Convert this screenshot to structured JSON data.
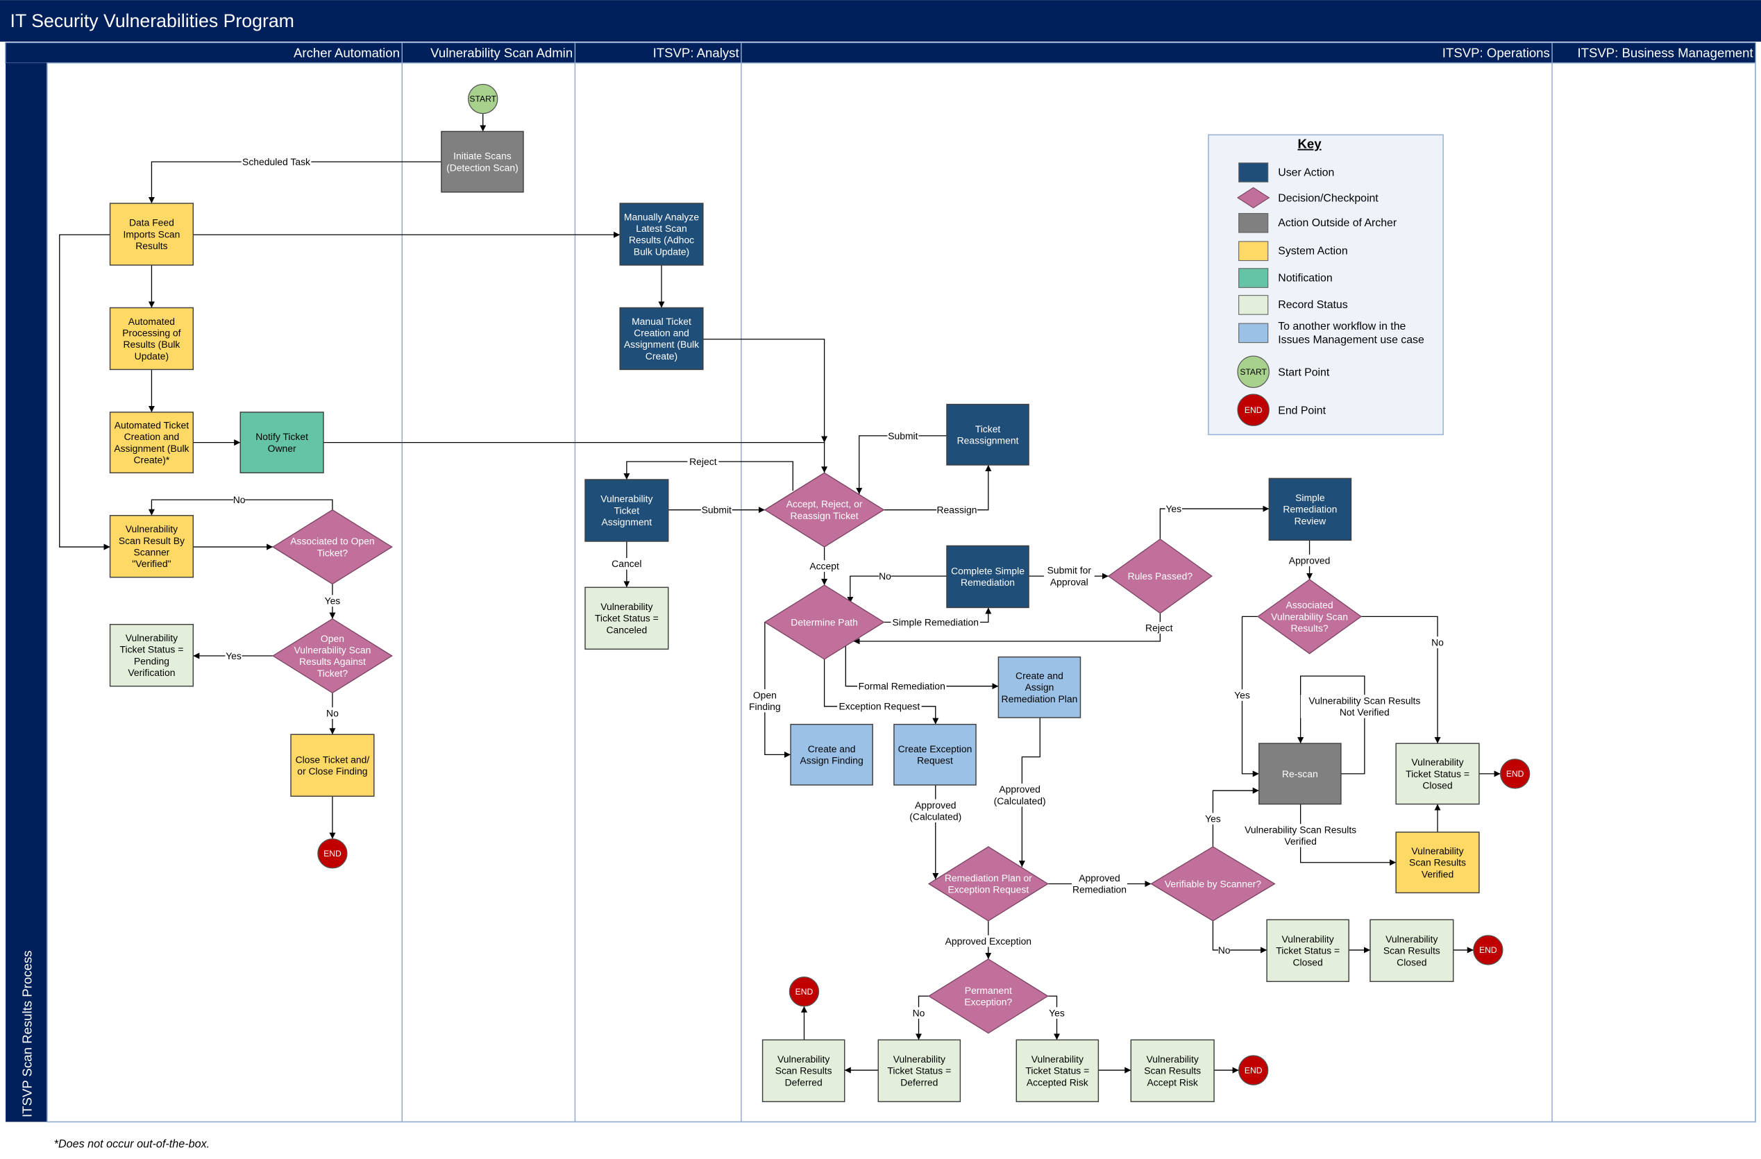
{
  "title": "IT Security Vulnerabilities Program",
  "process_label": "ITSVP Scan Results Process",
  "lanes": [
    "Archer Automation",
    "Vulnerability Scan Admin",
    "ITSVP: Analyst",
    "ITSVP: Operations",
    "ITSVP: Business Management"
  ],
  "footnote": "*Does not occur out-of-the-box.",
  "colors": {
    "header": "#00205B",
    "user_action": "#1F4E79",
    "decision": "#C0709A",
    "outside_archer": "#808080",
    "system_action": "#FFD966",
    "notification": "#66C4A6",
    "record_status": "#E3EFDA",
    "other_workflow": "#9BC2E6",
    "start": "#A9D18E",
    "end": "#C00000"
  },
  "key": {
    "title": "Key",
    "items": [
      {
        "type": "user_action",
        "label": "User Action"
      },
      {
        "type": "decision",
        "label": "Decision/Checkpoint"
      },
      {
        "type": "outside_archer",
        "label": "Action Outside of Archer"
      },
      {
        "type": "system_action",
        "label": "System Action"
      },
      {
        "type": "notification",
        "label": "Notification"
      },
      {
        "type": "record_status",
        "label": "Record Status"
      },
      {
        "type": "other_workflow",
        "label": "To another workflow in the\nIssues Management use case"
      },
      {
        "type": "start",
        "label": "Start Point",
        "symbol": "START"
      },
      {
        "type": "end",
        "label": "End Point",
        "symbol": "END"
      }
    ]
  },
  "nodes": {
    "start1": {
      "type": "start",
      "label": "START"
    },
    "initiate": {
      "type": "outside_archer",
      "label": "Initiate Scans\n(Detection Scan)"
    },
    "datafeed": {
      "type": "system_action",
      "label": "Data Feed\nImports Scan\nResults"
    },
    "autoproc": {
      "type": "system_action",
      "label": "Automated\nProcessing of\nResults (Bulk\nUpdate)"
    },
    "autoticket": {
      "type": "system_action",
      "label": "Automated Ticket\nCreation and\nAssignment (Bulk\nCreate)*"
    },
    "notify": {
      "type": "notification",
      "label": "Notify Ticket\nOwner"
    },
    "vsr_verified": {
      "type": "system_action",
      "label": "Vulnerability\nScan Result By\nScanner\n\"Verified\""
    },
    "dec_assoc_open": {
      "type": "decision",
      "label": "Associated to Open\nTicket?"
    },
    "dec_open_vsr": {
      "type": "decision",
      "label": "Open\nVulnerability Scan\nResults Against\nTicket?"
    },
    "pending": {
      "type": "record_status",
      "label": "Vulnerability\nTicket Status =\nPending\nVerification"
    },
    "close_ticket": {
      "type": "system_action",
      "label": "Close Ticket and/\nor Close Finding"
    },
    "end1": {
      "type": "end",
      "label": "END"
    },
    "manual_analyze": {
      "type": "user_action",
      "label": "Manually Analyze\nLatest Scan\nResults (Adhoc\nBulk Update)"
    },
    "manual_ticket": {
      "type": "user_action",
      "label": "Manual Ticket\nCreation and\nAssignment (Bulk\nCreate)"
    },
    "vta": {
      "type": "user_action",
      "label": "Vulnerability\nTicket\nAssignment"
    },
    "canceled": {
      "type": "record_status",
      "label": "Vulnerability\nTicket Status =\nCanceled"
    },
    "dec_accept": {
      "type": "decision",
      "label": "Accept, Reject, or\nReassign Ticket"
    },
    "ticket_reassign": {
      "type": "user_action",
      "label": "Ticket\nReassignment"
    },
    "dec_path": {
      "type": "decision",
      "label": "Determine Path"
    },
    "complete_simple": {
      "type": "user_action",
      "label": "Complete Simple\nRemediation"
    },
    "dec_rules": {
      "type": "decision",
      "label": "Rules Passed?"
    },
    "simple_review": {
      "type": "user_action",
      "label": "Simple\nRemediation\nReview"
    },
    "dec_assoc_vsr": {
      "type": "decision",
      "label": "Associated\nVulnerability Scan\nResults?"
    },
    "rescan": {
      "type": "outside_archer",
      "label": "Re-scan"
    },
    "vts_closed1": {
      "type": "record_status",
      "label": "Vulnerability\nTicket Status =\nClosed"
    },
    "end_a": {
      "type": "end",
      "label": "END"
    },
    "vsr_verified2": {
      "type": "system_action",
      "label": "Vulnerability\nScan Results\nVerified"
    },
    "create_plan": {
      "type": "other_workflow",
      "label": "Create and\nAssign\nRemediation Plan"
    },
    "create_finding": {
      "type": "other_workflow",
      "label": "Create and\nAssign Finding"
    },
    "create_exception": {
      "type": "other_workflow",
      "label": "Create Exception\nRequest"
    },
    "dec_plan": {
      "type": "decision",
      "label": "Remediation Plan or\nException Request"
    },
    "dec_verifiable": {
      "type": "decision",
      "label": "Verifiable by Scanner?"
    },
    "vts_closed2": {
      "type": "record_status",
      "label": "Vulnerability\nTicket Status =\nClosed"
    },
    "vsr_closed": {
      "type": "record_status",
      "label": "Vulnerability\nScan Results\nClosed"
    },
    "end_b": {
      "type": "end",
      "label": "END"
    },
    "dec_perm": {
      "type": "decision",
      "label": "Permanent\nException?"
    },
    "vsr_deferred": {
      "type": "record_status",
      "label": "Vulnerability\nScan Results\nDeferred"
    },
    "vts_deferred": {
      "type": "record_status",
      "label": "Vulnerability\nTicket Status =\nDeferred"
    },
    "vts_accepted": {
      "type": "record_status",
      "label": "Vulnerability\nTicket Status =\nAccepted Risk"
    },
    "vsr_accept": {
      "type": "record_status",
      "label": "Vulnerability\nScan Results\nAccept Risk"
    },
    "end_c": {
      "type": "end",
      "label": "END"
    },
    "end_d": {
      "type": "end",
      "label": "END"
    }
  },
  "edges": [
    {
      "from": "start1",
      "to": "initiate",
      "label": ""
    },
    {
      "from": "initiate",
      "to": "datafeed",
      "label": "Scheduled Task"
    },
    {
      "from": "datafeed",
      "to": "manual_analyze",
      "label": ""
    },
    {
      "from": "datafeed",
      "to": "vsr_verified",
      "label": ""
    },
    {
      "from": "datafeed",
      "to": "autoproc",
      "label": ""
    },
    {
      "from": "autoproc",
      "to": "autoticket",
      "label": ""
    },
    {
      "from": "autoticket",
      "to": "notify",
      "label": ""
    },
    {
      "from": "notify",
      "to": "dec_accept",
      "label": ""
    },
    {
      "from": "manual_analyze",
      "to": "manual_ticket",
      "label": ""
    },
    {
      "from": "manual_ticket",
      "to": "dec_accept",
      "label": ""
    },
    {
      "from": "vsr_verified",
      "to": "dec_assoc_open",
      "label": ""
    },
    {
      "from": "dec_assoc_open",
      "to": "vsr_verified",
      "label": "No"
    },
    {
      "from": "dec_assoc_open",
      "to": "dec_open_vsr",
      "label": "Yes"
    },
    {
      "from": "dec_open_vsr",
      "to": "pending",
      "label": "Yes"
    },
    {
      "from": "dec_open_vsr",
      "to": "close_ticket",
      "label": "No"
    },
    {
      "from": "close_ticket",
      "to": "end1",
      "label": ""
    },
    {
      "from": "ticket_reassign",
      "to": "dec_accept",
      "label": "Submit"
    },
    {
      "from": "dec_accept",
      "to": "ticket_reassign",
      "label": "Reassign"
    },
    {
      "from": "vta",
      "to": "dec_accept",
      "label": "Submit"
    },
    {
      "from": "dec_accept",
      "to": "vta",
      "label": "Reject"
    },
    {
      "from": "vta",
      "to": "canceled",
      "label": "Cancel"
    },
    {
      "from": "dec_accept",
      "to": "dec_path",
      "label": "Accept"
    },
    {
      "from": "complete_simple",
      "to": "dec_path",
      "label": "No"
    },
    {
      "from": "dec_path",
      "to": "complete_simple",
      "label": "Simple Remediation"
    },
    {
      "from": "complete_simple",
      "to": "dec_rules",
      "label": "Submit for\nApproval"
    },
    {
      "from": "dec_rules",
      "to": "simple_review",
      "label": "Yes"
    },
    {
      "from": "dec_rules",
      "to": "dec_path",
      "label": "Reject"
    },
    {
      "from": "dec_path",
      "to": "create_plan",
      "label": "Formal Remediation"
    },
    {
      "from": "dec_path",
      "to": "create_exception",
      "label": "Exception Request"
    },
    {
      "from": "dec_path",
      "to": "create_finding",
      "label": "Open\nFinding"
    },
    {
      "from": "simple_review",
      "to": "dec_assoc_vsr",
      "label": "Approved"
    },
    {
      "from": "dec_assoc_vsr",
      "to": "rescan",
      "label": "Yes"
    },
    {
      "from": "dec_assoc_vsr",
      "to": "vts_closed1",
      "label": "No"
    },
    {
      "from": "rescan",
      "to": "rescan",
      "label": "Vulnerability Scan Results\nNot Verified"
    },
    {
      "from": "rescan",
      "to": "vsr_verified2",
      "label": "Vulnerability Scan Results\nVerified"
    },
    {
      "from": "vsr_verified2",
      "to": "vts_closed1",
      "label": ""
    },
    {
      "from": "vts_closed1",
      "to": "end_a",
      "label": ""
    },
    {
      "from": "create_exception",
      "to": "dec_plan",
      "label": "Approved\n(Calculated)"
    },
    {
      "from": "create_plan",
      "to": "dec_plan",
      "label": "Approved\n(Calculated)"
    },
    {
      "from": "dec_plan",
      "to": "dec_verifiable",
      "label": "Approved\nRemediation"
    },
    {
      "from": "dec_verifiable",
      "to": "rescan",
      "label": "Yes"
    },
    {
      "from": "dec_verifiable",
      "to": "vts_closed2",
      "label": "No"
    },
    {
      "from": "vts_closed2",
      "to": "vsr_closed",
      "label": ""
    },
    {
      "from": "vsr_closed",
      "to": "end_b",
      "label": ""
    },
    {
      "from": "dec_plan",
      "to": "dec_perm",
      "label": "Approved Exception"
    },
    {
      "from": "dec_perm",
      "to": "vts_deferred",
      "label": "No"
    },
    {
      "from": "dec_perm",
      "to": "vts_accepted",
      "label": "Yes"
    },
    {
      "from": "vts_deferred",
      "to": "vsr_deferred",
      "label": ""
    },
    {
      "from": "vsr_deferred",
      "to": "end_d",
      "label": ""
    },
    {
      "from": "vts_accepted",
      "to": "vsr_accept",
      "label": ""
    },
    {
      "from": "vsr_accept",
      "to": "end_c",
      "label": ""
    }
  ]
}
